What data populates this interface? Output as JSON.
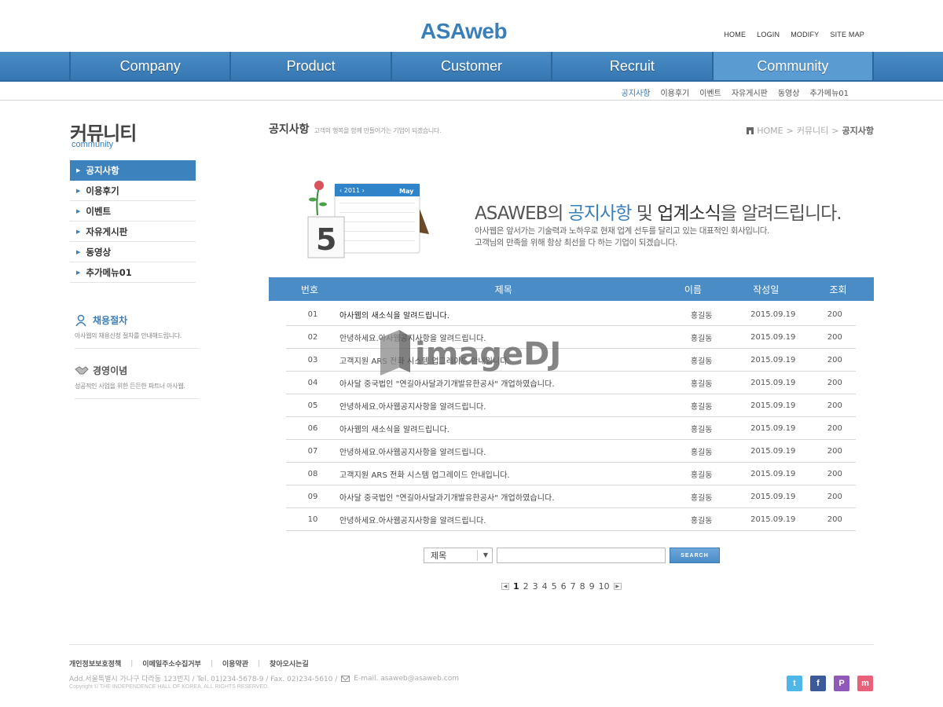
{
  "header": {
    "logo": "ASAweb",
    "top_links": [
      "HOME",
      "LOGIN",
      "MODIFY",
      "SITE MAP"
    ]
  },
  "gnb": {
    "items": [
      "Company",
      "Product",
      "Customer",
      "Recruit",
      "Community"
    ],
    "active": "Community"
  },
  "subnav": {
    "items": [
      "공지사항",
      "이용후기",
      "이벤트",
      "자유게시판",
      "동영상",
      "추가메뉴01"
    ],
    "active": "공지사항"
  },
  "lnb": {
    "title": "커뮤니티",
    "subtitle": "community",
    "items": [
      "공지사항",
      "이용후기",
      "이벤트",
      "자유게시판",
      "동영상",
      "추가메뉴01"
    ],
    "active": "공지사항"
  },
  "promos": [
    {
      "title": "채용절차",
      "desc": "아사웹의 채용신청 절차를 안내해드립니다.",
      "icon": "person-icon"
    },
    {
      "title": "경영이념",
      "desc": "성공적인 사업을 위한 든든한 파트너 아사웹.",
      "icon": "handshake-icon"
    }
  ],
  "content": {
    "title": "공지사항",
    "title_desc": "고객의 행복을 함께 만들어가는 기업이 되겠습니다.",
    "breadcrumb": [
      "HOME",
      "커뮤니티",
      "공지사항"
    ]
  },
  "banner": {
    "headline_pre": "ASAWEB의 ",
    "headline_blue": "공지사항",
    "headline_mid": " 및 ",
    "headline_strong": "업계소식",
    "headline_post": "을 알려드립니다.",
    "line1": "아사웹은 앞서가는 기술력과 노하우로 현재 업계 선두를 달리고 있는 대표적인 회사입니다.",
    "line2": "고객님의 만족을 위해 항상 최선을 다 하는 기업이 되겠습니다.",
    "calendar_year": "2011",
    "calendar_month": "May",
    "calendar_day": "5"
  },
  "board": {
    "headers": {
      "no": "번호",
      "title": "제목",
      "name": "이름",
      "date": "작성일",
      "hits": "조회"
    },
    "rows": [
      {
        "no": "01",
        "title": "아사웹의 새소식을 알려드립니다.",
        "name": "홍길동",
        "date": "2015.09.19",
        "hits": "200"
      },
      {
        "no": "02",
        "title": "안녕하세요.아사웹공지사항을 알려드립니다.",
        "name": "홍길동",
        "date": "2015.09.19",
        "hits": "200"
      },
      {
        "no": "03",
        "title": "고객지원 ARS 전화 시스템 업그레이드 안내입니다.",
        "name": "홍길동",
        "date": "2015.09.19",
        "hits": "200"
      },
      {
        "no": "04",
        "title": "아사달 중국법인 \"연길아사달과기개발유한공사\" 개업하였습니다.",
        "name": "홍길동",
        "date": "2015.09.19",
        "hits": "200"
      },
      {
        "no": "05",
        "title": "안녕하세요.아사웹공지사항을 알려드립니다.",
        "name": "홍길동",
        "date": "2015.09.19",
        "hits": "200"
      },
      {
        "no": "06",
        "title": "아사웹의 새소식을 알려드립니다.",
        "name": "홍길동",
        "date": "2015.09.19",
        "hits": "200"
      },
      {
        "no": "07",
        "title": "안녕하세요.아사웹공지사항을 알려드립니다.",
        "name": "홍길동",
        "date": "2015.09.19",
        "hits": "200"
      },
      {
        "no": "08",
        "title": "고객지원 ARS 전화 시스템 업그레이드 안내입니다.",
        "name": "홍길동",
        "date": "2015.09.19",
        "hits": "200"
      },
      {
        "no": "09",
        "title": "아사달 중국법인 \"연길아사달과기개발유한공사\" 개업하였습니다.",
        "name": "홍길동",
        "date": "2015.09.19",
        "hits": "200"
      },
      {
        "no": "10",
        "title": "안녕하세요.아사웹공지사항을 알려드립니다.",
        "name": "홍길동",
        "date": "2015.09.19",
        "hits": "200"
      }
    ]
  },
  "search": {
    "select_value": "제목",
    "input_value": "",
    "button": "SEARCH"
  },
  "pager": {
    "pages": [
      "1",
      "2",
      "3",
      "4",
      "5",
      "6",
      "7",
      "8",
      "9",
      "10"
    ],
    "current": "1"
  },
  "footer": {
    "links": [
      "개인정보보호정책",
      "이메일주소수집거부",
      "이용약관",
      "찾아오시는길"
    ],
    "address": "Add.서울특별시 가나구 다라동 123번지 / Tel. 01)234-5678-9 / Fax. 02)234-5610 /",
    "email": "E-mail. asaweb@asaweb.com",
    "copyright": "Copyright © THE INDEPENDENCE HALL OF KOREA. ALL RIGHTS RESERVED."
  },
  "sns": [
    {
      "name": "twitter-icon",
      "color": "#4fb6e8",
      "glyph": "t"
    },
    {
      "name": "facebook-icon",
      "color": "#3b5a9a",
      "glyph": "f"
    },
    {
      "name": "pinterest-icon",
      "color": "#8e59b8",
      "glyph": "P"
    },
    {
      "name": "me2day-icon",
      "color": "#e8607a",
      "glyph": "m"
    }
  ],
  "watermark": "imageDJ",
  "colors": {
    "brand": "#3a7fb9",
    "nav": "#4a8cc6",
    "nav_active": "#5a9bd2"
  }
}
